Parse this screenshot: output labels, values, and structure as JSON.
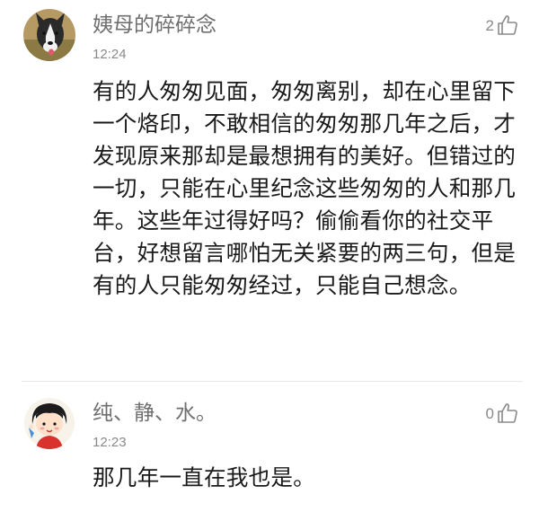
{
  "comments": [
    {
      "username": "姨母的碎碎念",
      "time": "12:24",
      "likes": "2",
      "avatar_icon": "husky-dog-avatar",
      "text": "有的人匆匆见面，匆匆离别，却在心里留下一个烙印，不敢相信的匆匆那几年之后，才发现原来那却是最想拥有的美好。但错过的一切，只能在心里纪念这些匆匆的人和那几年。这些年过得好吗？偷偷看你的社交平台，好想留言哪怕无关紧要的两三句，但是有的人只能匆匆经过，只能自己想念。"
    },
    {
      "username": "纯、静、水。",
      "time": "12:23",
      "likes": "0",
      "avatar_icon": "cartoon-girl-avatar",
      "text": "那几年一直在我也是。"
    }
  ],
  "colors": {
    "username": "#6f6f6f",
    "timestamp": "#8a8a8a",
    "body": "#1a1a1a",
    "divider": "#e8e8e8"
  }
}
